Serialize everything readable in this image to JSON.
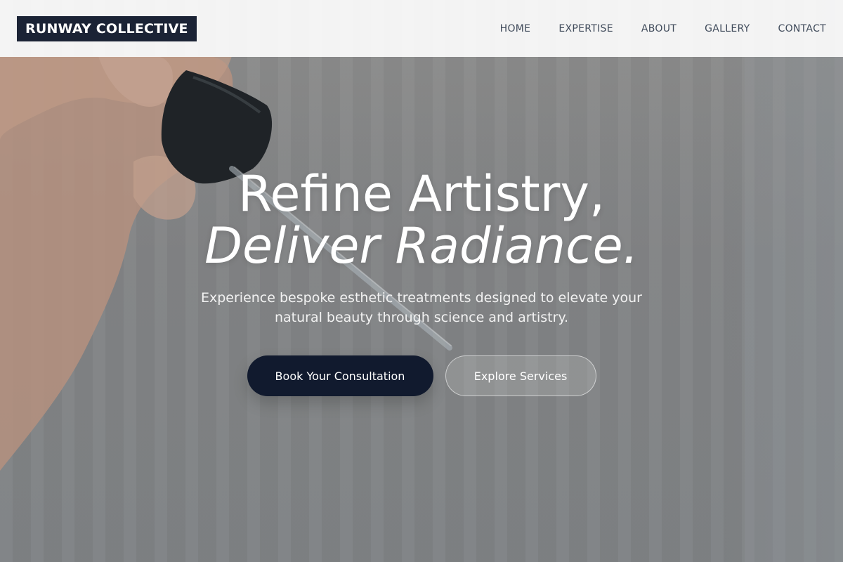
{
  "header": {
    "brand": "RUNWAY COLLECTIVE",
    "nav": [
      {
        "label": "HOME"
      },
      {
        "label": "EXPERTISE"
      },
      {
        "label": "ABOUT"
      },
      {
        "label": "GALLERY"
      },
      {
        "label": "CONTACT"
      }
    ]
  },
  "hero": {
    "headline_line1": "Refine Artistry,",
    "headline_line2": "Deliver Radiance.",
    "subtitle": "Experience bespoke esthetic treatments designed to elevate your natural beauty through science and artistry.",
    "primary_cta": "Book Your Consultation",
    "secondary_cta": "Explore Services"
  },
  "colors": {
    "brand_bg": "#1b2335",
    "primary_button": "#111a2e",
    "nav_text": "#3f4a5a"
  }
}
